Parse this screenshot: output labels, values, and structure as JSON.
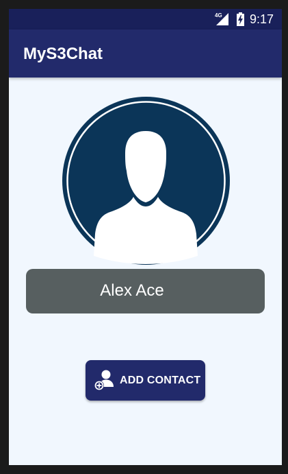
{
  "status_bar": {
    "network": "4G",
    "time": "9:17",
    "icons": [
      "signal-icon",
      "battery-charging-icon"
    ]
  },
  "app_bar": {
    "title": "MyS3Chat"
  },
  "profile": {
    "avatar_icon": "person-silhouette-icon",
    "name": "Alex Ace"
  },
  "actions": {
    "add_contact_label": "ADD CONTACT",
    "add_contact_icon": "add-contact-icon"
  },
  "colors": {
    "app_bar": "#222a6b",
    "status_bar": "#19205a",
    "background": "#f1f7fe",
    "avatar_circle": "#0b3558",
    "name_card": "#575f60",
    "button": "#222a6b"
  }
}
